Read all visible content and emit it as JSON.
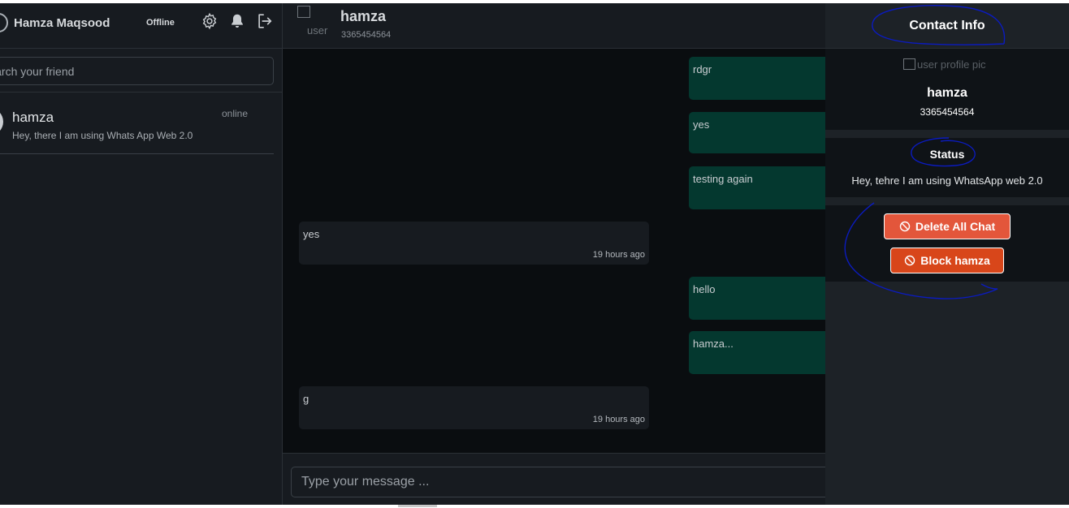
{
  "sidebar": {
    "user_name": "Hamza Maqsood",
    "status": "Offline",
    "icons": [
      "gear-icon",
      "bell-icon",
      "logout-icon"
    ],
    "search_placeholder": "Search your friend",
    "contacts": [
      {
        "name": "hamza",
        "status": "online",
        "last_message": "Hey, there I am using Whats App Web 2.0"
      }
    ]
  },
  "chat": {
    "avatar_alt": "user",
    "name": "hamza",
    "phone": "3365454564",
    "messages": [
      {
        "direction": "out",
        "text": "rdgr"
      },
      {
        "direction": "out",
        "text": "yes"
      },
      {
        "direction": "out",
        "text": "testing again"
      },
      {
        "direction": "in",
        "text": "yes",
        "time": "19 hours ago"
      },
      {
        "direction": "out",
        "text": "hello"
      },
      {
        "direction": "out",
        "text": "hamza..."
      },
      {
        "direction": "in",
        "text": "g",
        "time": "19 hours ago"
      }
    ],
    "input_placeholder": "Type your message ..."
  },
  "contact_info": {
    "title": "Contact Info",
    "profile_pic_alt": "user profile pic",
    "name": "hamza",
    "phone": "3365454564",
    "status_label": "Status",
    "status_message": "Hey, tehre I am using WhatsApp web 2.0",
    "delete_label": "Delete All Chat",
    "block_label": "Block hamza"
  },
  "colors": {
    "outgoing_bubble": "#04382f",
    "incoming_bubble": "#171b20",
    "delete_button": "#e3563b",
    "block_button": "#d8461a",
    "annotation_ink": "#0b1bbf"
  }
}
